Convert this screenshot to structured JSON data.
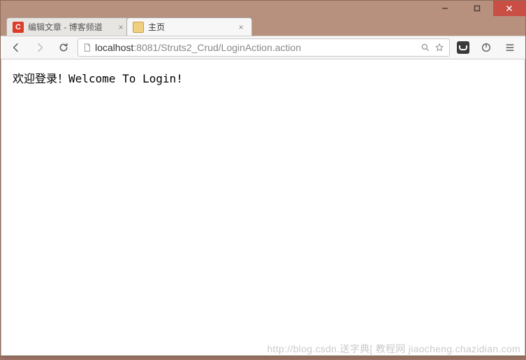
{
  "window": {
    "controls": {
      "minimize": "–",
      "maximize": "□",
      "close": "✕"
    }
  },
  "tabs": [
    {
      "title": "编辑文章 - 博客频道",
      "favicon": "C",
      "active": false
    },
    {
      "title": "主页",
      "favicon": "",
      "active": true
    }
  ],
  "toolbar": {
    "url_host": "localhost",
    "url_port_path": ":8081/Struts2_Crud/LoginAction.action"
  },
  "page": {
    "welcome": "欢迎登录！Welcome To Login!"
  },
  "watermark": "http://blog.csdn.送字典[ 教程网  jiaocheng.chazidian.com"
}
